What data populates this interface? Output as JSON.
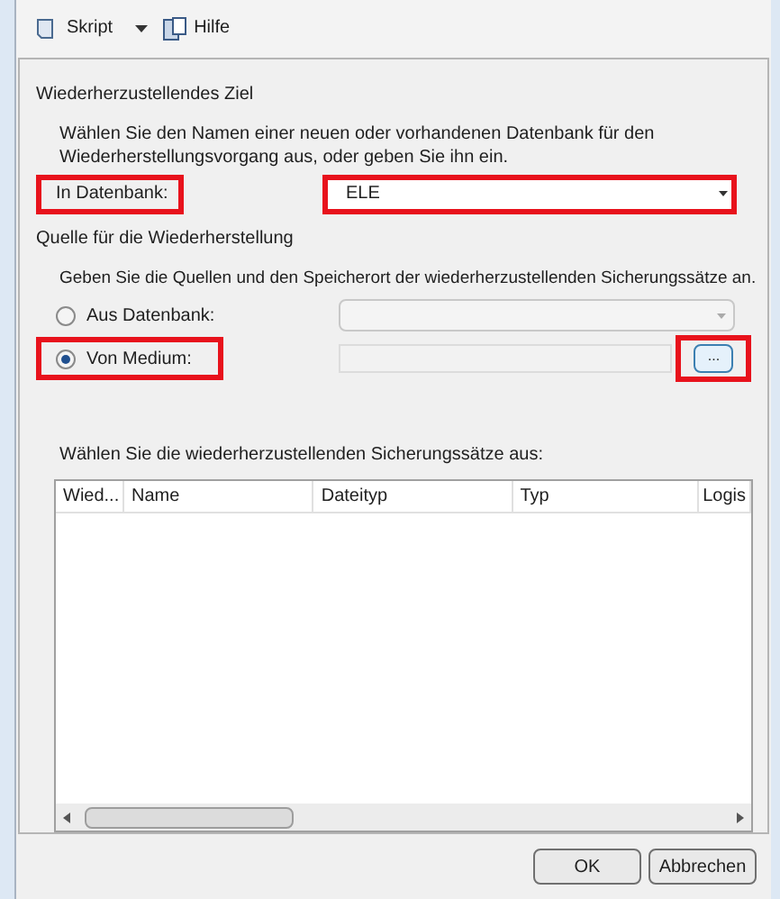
{
  "toolbar": {
    "items": [
      {
        "label": "Skript",
        "kind": "dropdown"
      },
      {
        "label": "Hilfe",
        "kind": "plain"
      }
    ]
  },
  "target": {
    "heading": "Wiederherzustellendes Ziel",
    "description": "Wählen Sie den Namen einer neuen oder vorhandenen Datenbank für den Wiederherstellungsvorgang aus, oder geben Sie ihn ein.",
    "label": "In Datenbank:",
    "label_highlighted": true,
    "value": "ELE",
    "field_highlighted": true
  },
  "source": {
    "heading": "Quelle für die Wiederherstellung",
    "description": "Geben Sie die Quellen und den Speicherort der wiederherzustellenden Sicherungssätze an.",
    "options": [
      {
        "label": "Aus Datenbank:",
        "selected": false,
        "highlighted": false,
        "kind": "combo"
      },
      {
        "label": "Von Medium:",
        "selected": true,
        "highlighted": true,
        "kind": "browse"
      }
    ],
    "browse_button": {
      "label": "...",
      "highlighted": true
    }
  },
  "backup_sets": {
    "label": "Wählen Sie die wiederherzustellenden Sicherungssätze aus:",
    "columns": [
      "Wied...",
      "Name",
      "Dateityp",
      "Typ",
      "Logis"
    ]
  },
  "buttons": [
    "OK",
    "Abbrechen"
  ]
}
